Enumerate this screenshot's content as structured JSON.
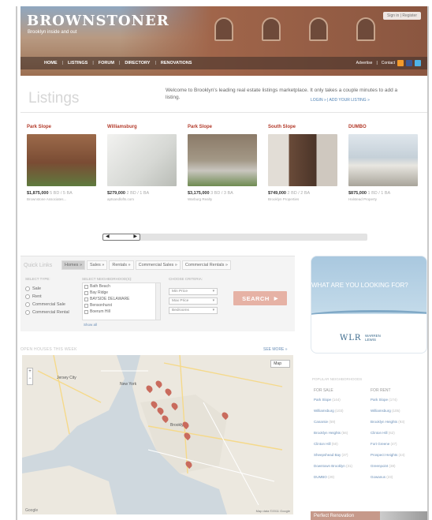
{
  "header": {
    "logo": "BROWNSTONER",
    "tagline": "Brooklyn inside and out",
    "signin": "Sign in | Register",
    "nav": [
      "HOME",
      "LISTINGS",
      "FORUM",
      "DIRECTORY",
      "RENOVATIONS"
    ],
    "nav_right": [
      "Advertise",
      "Contact"
    ],
    "social": [
      "rss",
      "facebook",
      "twitter"
    ]
  },
  "intro": {
    "title": "Listings",
    "text": "Welcome to Brooklyn's leading real estate listings marketplace. It only takes a couple minutes to add a listing.",
    "login": "LOGIN »",
    "add": "ADD YOUR LISTING »"
  },
  "cards": [
    {
      "neighborhood": "Park Slope",
      "price": "$1,875,000",
      "beds": "5 BD / 5 BA",
      "agent": "Brownstone Associates...",
      "color": "#8a5a3c"
    },
    {
      "neighborhood": "Williamsburg",
      "price": "$279,000",
      "beds": "2 BD / 1 BA",
      "agent": "aptsandlofts.com",
      "color": "#d9d9d6"
    },
    {
      "neighborhood": "Park Slope",
      "price": "$3,175,000",
      "beds": "3 BD / 3 BA",
      "agent": "Warburg Realty",
      "color": "#7e8c78"
    },
    {
      "neighborhood": "South Slope",
      "price": "$749,000",
      "beds": "2 BD / 2 BA",
      "agent": "Brooklyn Properties",
      "color": "#6e5140"
    },
    {
      "neighborhood": "DUMBO",
      "price": "$875,000",
      "beds": "1 BD / 1 BA",
      "agent": "Halstead Property",
      "color": "#c8d3dc"
    }
  ],
  "quick_links": {
    "title": "Quick Links",
    "tabs": [
      "Homes »",
      "Sales »",
      "Rentals »",
      "Commercial Sales »",
      "Commercial Rentals »"
    ],
    "col1_heading": "SELECT TYPE:",
    "col2_heading": "SELECT NEIGHBORHOOD(S):",
    "col3_heading": "CHOOSE CRITERIA:",
    "types": [
      "Sale",
      "Rent",
      "Commercial Sale",
      "Commercial Rental"
    ],
    "neighborhoods": [
      "Bath Beach",
      "Bay Ridge",
      "BAYSIDE DELAWARE",
      "Bensonhurst",
      "Boerum Hill"
    ],
    "show_all": "Show all",
    "min_price": "Min Price",
    "max_price": "Max Price",
    "bedrooms": "Bedrooms",
    "search_label": "SEARCH"
  },
  "open_houses": {
    "heading": "OPEN HOUSES THIS WEEK",
    "see_more": "SEE MORE »",
    "map_type": "Map",
    "map_labels": [
      "Jersey City",
      "New York",
      "Brooklyn"
    ],
    "map_footer": "Map data ©2011 Google",
    "google": "Google"
  },
  "sidebar": {
    "ad_question": "WHAT ARE YOU LOOKING FOR?",
    "ad_brand": "WLR",
    "ad_brand2_line1": "WARREN",
    "ad_brand2_line2": "LEWIS",
    "popular_heading": "POPULAR NEIGHBORHOODS",
    "for_sale": "FOR SALE",
    "for_rent": "FOR RENT",
    "sale_items": [
      {
        "name": "Park Slope",
        "count": "(144)"
      },
      {
        "name": "Williamsburg",
        "count": "(103)"
      },
      {
        "name": "Canarsie",
        "count": "(59)"
      },
      {
        "name": "Brooklyn Heights",
        "count": "(56)"
      },
      {
        "name": "Clinton Hill",
        "count": "(50)"
      },
      {
        "name": "Sheepshead Bay",
        "count": "(37)"
      },
      {
        "name": "Downtown Brooklyn",
        "count": "(31)"
      },
      {
        "name": "DUMBO",
        "count": "(29)"
      }
    ],
    "rent_items": [
      {
        "name": "Park Slope",
        "count": "(174)"
      },
      {
        "name": "Williamsburg",
        "count": "(105)"
      },
      {
        "name": "Brooklyn Heights",
        "count": "(93)"
      },
      {
        "name": "Clinton Hill",
        "count": "(62)"
      },
      {
        "name": "Fort Greene",
        "count": "(47)"
      },
      {
        "name": "Prospect Heights",
        "count": "(44)"
      },
      {
        "name": "Greenpoint",
        "count": "(38)"
      },
      {
        "name": "Gowanus",
        "count": "(23)"
      }
    ],
    "perfect": "Perfect Renovation"
  }
}
